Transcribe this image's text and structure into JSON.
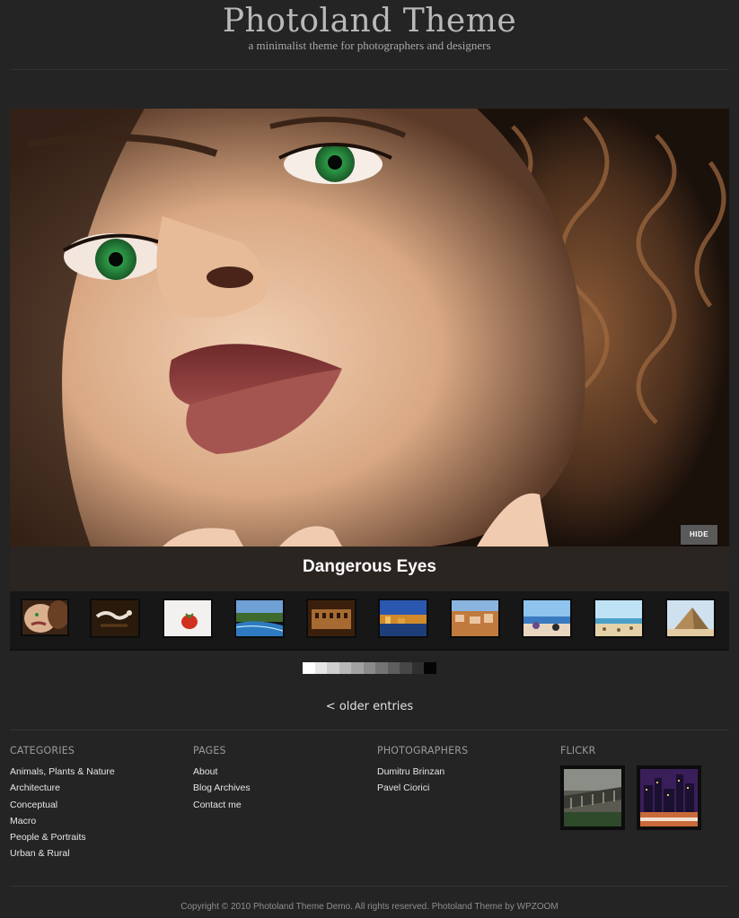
{
  "site": {
    "title": "Photoland Theme",
    "description": "a minimalist theme for photographers and designers"
  },
  "slider": {
    "hide_label": "HIDE",
    "caption": "Dangerous Eyes",
    "thumbnails": [
      {
        "name": "portrait-woman",
        "active": true
      },
      {
        "name": "floating-figures"
      },
      {
        "name": "strawberry"
      },
      {
        "name": "river-landscape"
      },
      {
        "name": "old-building-street"
      },
      {
        "name": "coastal-town-sunset"
      },
      {
        "name": "village-houses"
      },
      {
        "name": "beach-people"
      },
      {
        "name": "sea-coast"
      },
      {
        "name": "pyramid"
      }
    ],
    "pager_count": 11,
    "pager_colors": [
      "#ffffff",
      "#e6e6e6",
      "#cfcfcf",
      "#b8b8b8",
      "#a2a2a2",
      "#8b8b8b",
      "#747474",
      "#5e5e5e",
      "#474747",
      "#303030",
      "#050505"
    ]
  },
  "navigation": {
    "older_entries": "< older entries"
  },
  "footer": {
    "categories": {
      "title": "CATEGORIES",
      "items": [
        "Animals, Plants & Nature",
        "Architecture",
        "Conceptual",
        "Macro",
        "People & Portraits",
        "Urban & Rural"
      ]
    },
    "pages": {
      "title": "PAGES",
      "items": [
        "About",
        "Blog Archives",
        "Contact me"
      ]
    },
    "photographers": {
      "title": "PHOTOGRAPHERS",
      "items": [
        "Dumitru Brinzan",
        "Pavel Ciorici"
      ]
    },
    "flickr": {
      "title": "FLICKR"
    },
    "copyright": "Copyright © 2010 Photoland Theme Demo. All rights reserved. Photoland Theme by WPZOOM"
  }
}
